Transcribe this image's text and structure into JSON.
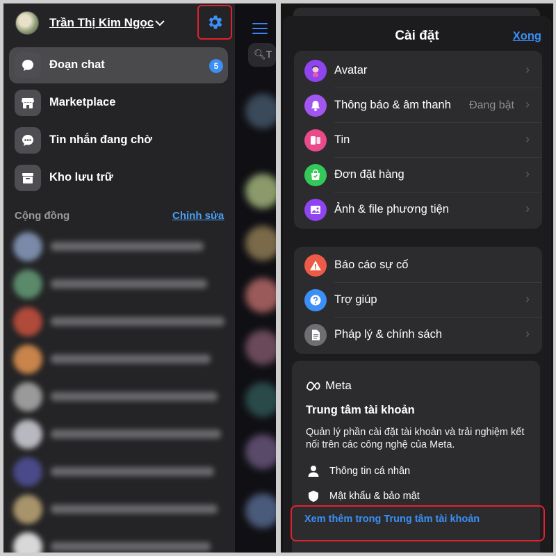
{
  "left_panel": {
    "user": {
      "name": "Trần Thị Kim Ngọc"
    },
    "menu": [
      {
        "label": "Đoạn chat",
        "icon": "chat-bubble-icon",
        "badge": "5",
        "active": true
      },
      {
        "label": "Marketplace",
        "icon": "storefront-icon"
      },
      {
        "label": "Tin nhắn đang chờ",
        "icon": "message-dots-icon"
      },
      {
        "label": "Kho lưu trữ",
        "icon": "archive-box-icon"
      }
    ],
    "communities_section": {
      "title": "Cộng đồng",
      "edit_label": "Chỉnh sửa"
    },
    "search_glyph": "T"
  },
  "right_panel": {
    "title": "Cài đặt",
    "done_label": "Xong",
    "group1": [
      {
        "label": "Avatar",
        "icon": "avatar-icon",
        "color": "#8e44ef"
      },
      {
        "label": "Thông báo & âm thanh",
        "value": "Đang bật",
        "icon": "bell-icon",
        "color": "#a156f0"
      },
      {
        "label": "Tin",
        "icon": "stories-icon",
        "color": "#e84a8a"
      },
      {
        "label": "Đơn đặt hàng",
        "icon": "shopping-bag-icon",
        "color": "#34c759"
      },
      {
        "label": "Ảnh & file phương tiện",
        "icon": "photo-icon",
        "color": "#8e44ef"
      }
    ],
    "group2": [
      {
        "label": "Báo cáo sự cố",
        "icon": "warning-icon",
        "color": "#ee5a48"
      },
      {
        "label": "Trợ giúp",
        "icon": "question-icon",
        "color": "#3b8ff6"
      },
      {
        "label": "Pháp lý & chính sách",
        "icon": "document-icon",
        "color": "#6e6e73"
      }
    ],
    "account_center": {
      "brand": "Meta",
      "title": "Trung tâm tài khoản",
      "description": "Quản lý phần cài đặt tài khoản và trải nghiệm kết nối trên các công nghệ của Meta.",
      "items": [
        {
          "label": "Thông tin cá nhân",
          "icon": "person-icon"
        },
        {
          "label": "Mật khẩu & bảo mật",
          "icon": "shield-icon"
        }
      ],
      "link_label": "Xem thêm trong Trung tâm tài khoản"
    }
  }
}
